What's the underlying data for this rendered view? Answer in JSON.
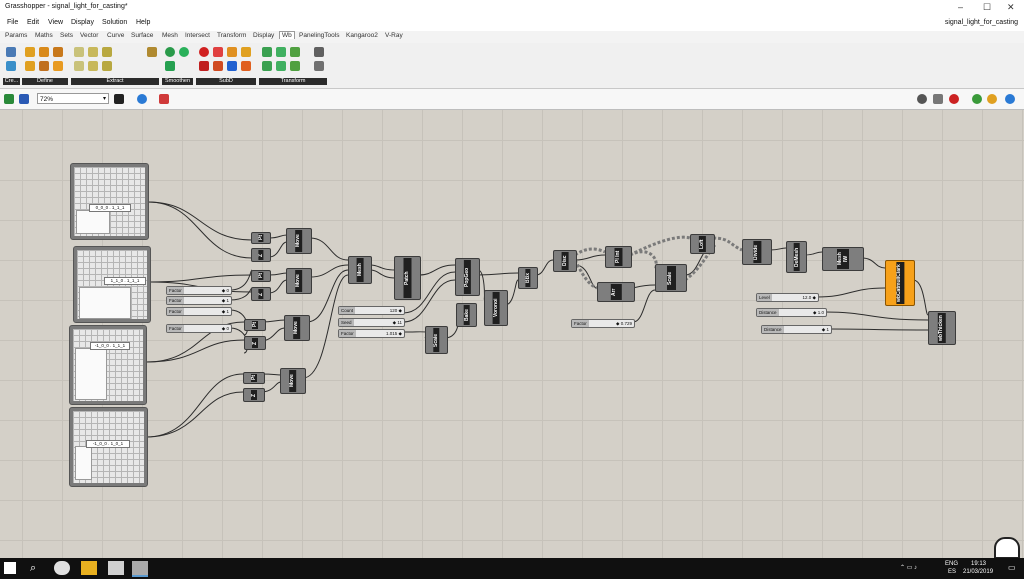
{
  "window": {
    "title": "Grasshopper - signal_light_for_casting*",
    "doc_name": "signal_light_for_casting"
  },
  "menu": [
    "File",
    "Edit",
    "View",
    "Display",
    "Solution",
    "Help"
  ],
  "tabs": [
    "Params",
    "Maths",
    "Sets",
    "Vector",
    "Curve",
    "Surface",
    "Mesh",
    "Intersect",
    "Transform",
    "Display",
    "Wb",
    "PanelingTools",
    "Kangaroo2",
    "V-Ray"
  ],
  "active_tab": "Wb",
  "ribbon_groups": [
    "Cre...",
    "Define",
    "Extract",
    "Smoothen",
    "SubD",
    "Transform"
  ],
  "zoom": "72%",
  "panels": [
    "0_0_0 . 1_1_1",
    "1_1_0 . 1_1_1",
    "-1_0_0 . 1_1_1",
    "-1_0_0 . 1_0_1"
  ],
  "components": [
    "Pt",
    "Z",
    "Move",
    "Pt",
    "Z",
    "Move",
    "Pt",
    "Z",
    "Move",
    "Pt",
    "Z",
    "Move",
    "Mesh",
    "Patch",
    "PopGeo",
    "Voronoi",
    "BBx",
    "Scale",
    "Bake",
    "Disc",
    "Pl Int",
    "Arr",
    "Loft",
    "Scale",
    "Divide",
    "DeMesh",
    "Mesh IW",
    "wbJoin",
    "wbCatmullClark",
    "wbThicken"
  ],
  "sliders": [
    {
      "label": "Factor",
      "value": "◆ 0"
    },
    {
      "label": "Factor",
      "value": "◆ 1"
    },
    {
      "label": "Factor",
      "value": "◆ 1"
    },
    {
      "label": "Factor",
      "value": "◆ 0"
    },
    {
      "label": "Count",
      "value": "120 ◆"
    },
    {
      "label": "Seed",
      "value": "◆ 11"
    },
    {
      "label": "Factor",
      "value": "1.015 ◆"
    },
    {
      "label": "Factor",
      "value": "◆ 0.729"
    },
    {
      "label": "Level",
      "value": "12.0 ◆"
    },
    {
      "label": "Distance",
      "value": "◆ 1.0"
    },
    {
      "label": "Distance",
      "value": "◆ 1"
    }
  ],
  "taskbar": {
    "lang": "ENG",
    "region": "ES",
    "time": "19:13",
    "date": "21/03/2019"
  }
}
